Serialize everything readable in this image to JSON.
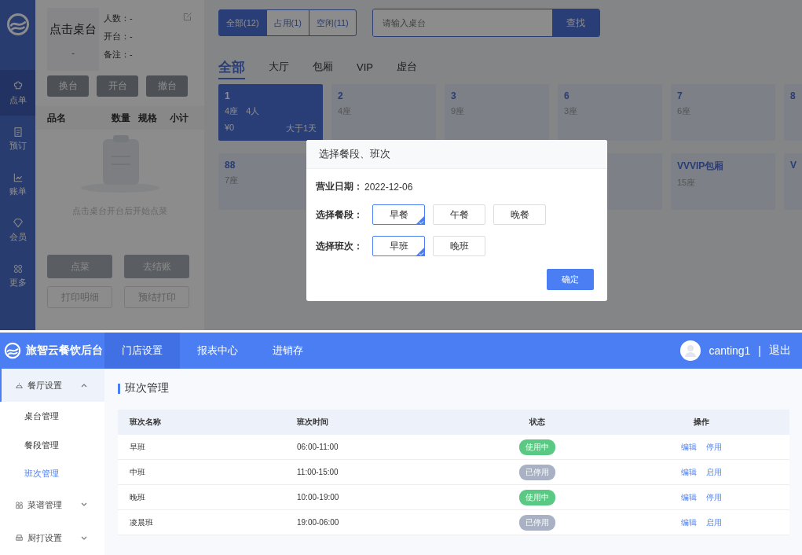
{
  "pos": {
    "sidebar": [
      {
        "label": "点单",
        "selected": true
      },
      {
        "label": "预订",
        "selected": false
      },
      {
        "label": "账单",
        "selected": false
      },
      {
        "label": "会员",
        "selected": false
      },
      {
        "label": "更多",
        "selected": false
      }
    ],
    "order_panel": {
      "table_name": "点击桌台",
      "table_sub": "-",
      "info": [
        {
          "label": "人数：",
          "value": "-"
        },
        {
          "label": "开台：",
          "value": "-"
        },
        {
          "label": "备注：",
          "value": "-"
        }
      ],
      "actions": [
        "换台",
        "开台",
        "撤台"
      ],
      "columns": [
        "品名",
        "数量",
        "规格",
        "小计"
      ],
      "empty_text": "点击桌台开台后开始点菜",
      "buttons": [
        {
          "label": "点菜",
          "kind": "filled"
        },
        {
          "label": "去结账",
          "kind": "filled"
        },
        {
          "label": "打印明细",
          "kind": "outline"
        },
        {
          "label": "预结打印",
          "kind": "outline"
        }
      ]
    },
    "filters": [
      {
        "label": "全部(12)",
        "selected": true
      },
      {
        "label": "占用(1)",
        "selected": false
      },
      {
        "label": "空闲(11)",
        "selected": false
      }
    ],
    "search": {
      "placeholder": "请输入桌台",
      "button": "查找"
    },
    "areas": [
      {
        "label": "全部",
        "selected": true
      },
      {
        "label": "大厅",
        "selected": false
      },
      {
        "label": "包厢",
        "selected": false
      },
      {
        "label": "VIP",
        "selected": false
      },
      {
        "label": "虚台",
        "selected": false
      }
    ],
    "tables": [
      [
        {
          "name": "1",
          "seats": "4座",
          "guests": "4人",
          "amount": "¥0",
          "duration": "大于1天",
          "selected": true
        },
        {
          "name": "2",
          "seats": "4座",
          "selected": false
        },
        {
          "name": "3",
          "seats": "9座",
          "selected": false
        },
        {
          "name": "6",
          "seats": "3座",
          "selected": false
        },
        {
          "name": "7",
          "seats": "6座",
          "selected": false
        },
        {
          "name": "8",
          "selected": false
        }
      ],
      [
        {
          "name": "88",
          "seats": "7座",
          "selected": false
        },
        {
          "name": "VVVIP包厢",
          "seats": "15座",
          "selected": false
        },
        {
          "name": "V",
          "selected": false
        }
      ]
    ],
    "dialog": {
      "title": "选择餐段、班次",
      "date_label": "营业日期：",
      "date": "2022-12-06",
      "groups": [
        {
          "label": "选择餐段：",
          "options": [
            {
              "label": "早餐",
              "selected": true
            },
            {
              "label": "午餐",
              "selected": false
            },
            {
              "label": "晚餐",
              "selected": false
            }
          ]
        },
        {
          "label": "选择班次：",
          "options": [
            {
              "label": "早班",
              "selected": true
            },
            {
              "label": "晚班",
              "selected": false
            }
          ]
        }
      ],
      "confirm": "确定"
    }
  },
  "admin": {
    "brand": "旅智云餐饮后台",
    "nav": [
      {
        "label": "门店设置",
        "selected": true
      },
      {
        "label": "报表中心",
        "selected": false
      },
      {
        "label": "进销存",
        "selected": false
      }
    ],
    "user": "canting1",
    "separator": "|",
    "logout": "退出",
    "menu": [
      {
        "label": "餐厅设置",
        "expanded": true,
        "selected": true,
        "children": [
          {
            "label": "桌台管理",
            "selected": false
          },
          {
            "label": "餐段管理",
            "selected": false
          },
          {
            "label": "班次管理",
            "selected": true
          }
        ]
      },
      {
        "label": "菜谱管理",
        "expanded": false,
        "selected": false
      },
      {
        "label": "厨打设置",
        "expanded": false,
        "selected": false
      }
    ],
    "page_title": "班次管理",
    "table": {
      "columns": [
        "班次名称",
        "班次时间",
        "状态",
        "操作"
      ],
      "rows": [
        {
          "name": "早班",
          "time": "06:00-11:00",
          "status": "使用中",
          "active": true,
          "actions": [
            "编辑",
            "停用"
          ]
        },
        {
          "name": "中班",
          "time": "11:00-15:00",
          "status": "已停用",
          "active": false,
          "actions": [
            "编辑",
            "启用"
          ]
        },
        {
          "name": "晚班",
          "time": "10:00-19:00",
          "status": "使用中",
          "active": true,
          "actions": [
            "编辑",
            "停用"
          ]
        },
        {
          "name": "凌晨班",
          "time": "19:00-06:00",
          "status": "已停用",
          "active": false,
          "actions": [
            "编辑",
            "启用"
          ]
        }
      ]
    }
  }
}
